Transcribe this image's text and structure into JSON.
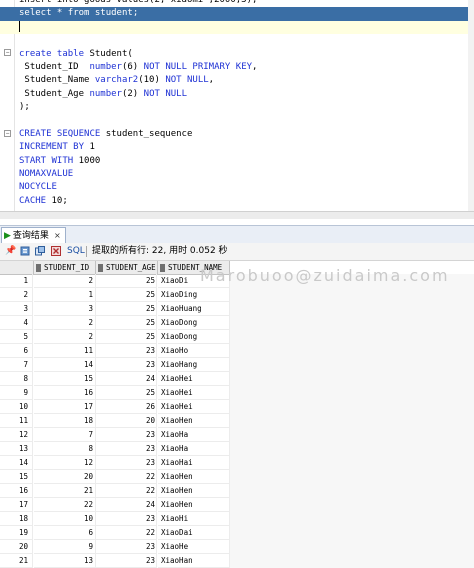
{
  "editor": {
    "lines": [
      {
        "segs": [
          {
            "t": "insert into goods values(2,'xiaomi',2000,3);",
            "k": false
          }
        ]
      },
      {
        "segs": [
          {
            "t": "select",
            "k": true
          },
          {
            "t": " * ",
            "k": false
          },
          {
            "t": "from",
            "k": true
          },
          {
            "t": " student;",
            "k": false
          }
        ],
        "sel": true
      },
      {
        "segs": [],
        "cur": true
      },
      {
        "segs": []
      },
      {
        "segs": [
          {
            "t": "create table",
            "k": true
          },
          {
            "t": " Student(",
            "k": false
          }
        ]
      },
      {
        "segs": [
          {
            "t": " Student_ID  ",
            "k": false
          },
          {
            "t": "number",
            "k": true
          },
          {
            "t": "(6) ",
            "k": false
          },
          {
            "t": "NOT NULL PRIMARY KEY",
            "k": true
          },
          {
            "t": ",",
            "k": false
          }
        ]
      },
      {
        "segs": [
          {
            "t": " Student_Name ",
            "k": false
          },
          {
            "t": "varchar2",
            "k": true
          },
          {
            "t": "(10) ",
            "k": false
          },
          {
            "t": "NOT NULL",
            "k": true
          },
          {
            "t": ",",
            "k": false
          }
        ]
      },
      {
        "segs": [
          {
            "t": " Student_Age ",
            "k": false
          },
          {
            "t": "number",
            "k": true
          },
          {
            "t": "(2) ",
            "k": false
          },
          {
            "t": "NOT NULL",
            "k": true
          }
        ]
      },
      {
        "segs": [
          {
            "t": ");",
            "k": false
          }
        ]
      },
      {
        "segs": []
      },
      {
        "segs": [
          {
            "t": "CREATE SEQUENCE",
            "k": true
          },
          {
            "t": " student_sequence",
            "k": false
          }
        ]
      },
      {
        "segs": [
          {
            "t": "INCREMENT BY",
            "k": true
          },
          {
            "t": " 1",
            "k": false
          }
        ]
      },
      {
        "segs": [
          {
            "t": "START WITH",
            "k": true
          },
          {
            "t": " 1000",
            "k": false
          }
        ]
      },
      {
        "segs": [
          {
            "t": "NOMAXVALUE",
            "k": true
          }
        ]
      },
      {
        "segs": [
          {
            "t": "NOCYCLE",
            "k": true
          }
        ]
      },
      {
        "segs": [
          {
            "t": "CACHE",
            "k": true
          },
          {
            "t": " 10;",
            "k": false
          }
        ]
      }
    ]
  },
  "results_tab": {
    "label": "查询结果",
    "close": "×"
  },
  "toolbar": {
    "sql_label": "SQL",
    "status": "提取的所有行: 22, 用时 0.052 秒"
  },
  "grid": {
    "columns": [
      "STUDENT_ID",
      "STUDENT_AGE",
      "STUDENT_NAME"
    ],
    "rows": [
      {
        "no": "1",
        "id": "2",
        "age": "25",
        "name": "XiaoDi"
      },
      {
        "no": "2",
        "id": "1",
        "age": "25",
        "name": "XiaoDing"
      },
      {
        "no": "3",
        "id": "3",
        "age": "25",
        "name": "XiaoHuang"
      },
      {
        "no": "4",
        "id": "2",
        "age": "25",
        "name": "XiaoDong"
      },
      {
        "no": "5",
        "id": "2",
        "age": "25",
        "name": "XiaoDong"
      },
      {
        "no": "6",
        "id": "11",
        "age": "23",
        "name": "XiaoHo"
      },
      {
        "no": "7",
        "id": "14",
        "age": "23",
        "name": "XiaoHang"
      },
      {
        "no": "8",
        "id": "15",
        "age": "24",
        "name": "XiaoHei"
      },
      {
        "no": "9",
        "id": "16",
        "age": "25",
        "name": "XiaoHei"
      },
      {
        "no": "10",
        "id": "17",
        "age": "26",
        "name": "XiaoHei"
      },
      {
        "no": "11",
        "id": "18",
        "age": "20",
        "name": "XiaoHen"
      },
      {
        "no": "12",
        "id": "7",
        "age": "23",
        "name": "XiaoHa"
      },
      {
        "no": "13",
        "id": "8",
        "age": "23",
        "name": "XiaoHa"
      },
      {
        "no": "14",
        "id": "12",
        "age": "23",
        "name": "XiaoHai"
      },
      {
        "no": "15",
        "id": "20",
        "age": "22",
        "name": "XiaoHen"
      },
      {
        "no": "16",
        "id": "21",
        "age": "22",
        "name": "XiaoHen"
      },
      {
        "no": "17",
        "id": "22",
        "age": "24",
        "name": "XiaoHen"
      },
      {
        "no": "18",
        "id": "10",
        "age": "23",
        "name": "XiaoHi"
      },
      {
        "no": "19",
        "id": "6",
        "age": "22",
        "name": "XiaoDai"
      },
      {
        "no": "20",
        "id": "9",
        "age": "23",
        "name": "XiaoHe"
      },
      {
        "no": "21",
        "id": "13",
        "age": "23",
        "name": "XiaoHan"
      }
    ]
  },
  "watermark": "Marobuoo@zuidaima.com"
}
